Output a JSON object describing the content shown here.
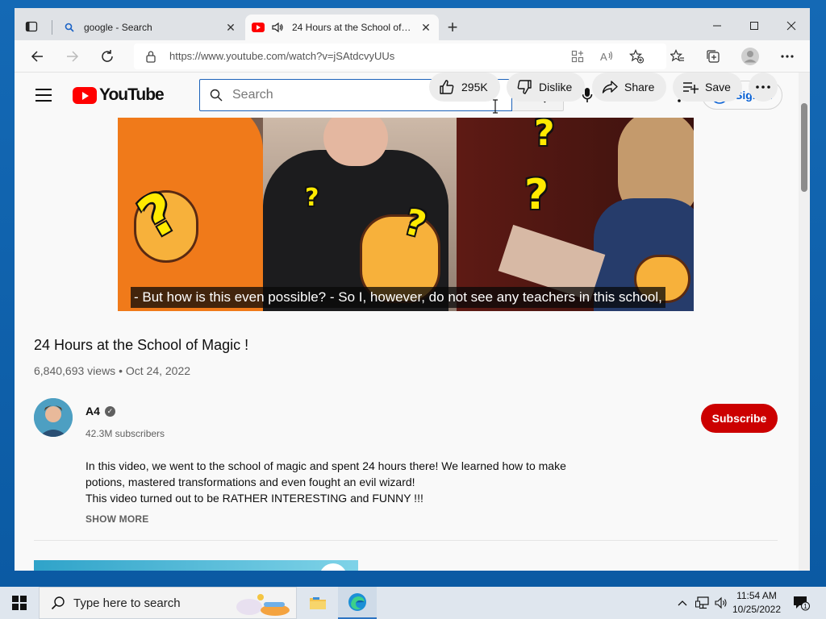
{
  "browser": {
    "tabs": [
      {
        "title": "google - Search",
        "active": false,
        "icon": "search-icon"
      },
      {
        "title": "24 Hours at the School of Magic",
        "active": true,
        "icon": "youtube-icon",
        "audio": true
      }
    ],
    "address_url": "https://www.youtube.com/watch?v=jSAtdcvyUUs"
  },
  "youtube": {
    "logo_text": "YouTube",
    "search_placeholder": "Search",
    "sign_in_label": "Sign in",
    "video": {
      "subtitle": "- But how is this even possible? - So I, however, do not see any teachers in this school,",
      "title": "24 Hours at the School of Magic !",
      "meta": "6,840,693 views • Oct 24, 2022"
    },
    "actions": {
      "like": "295K",
      "dislike": "Dislike",
      "share": "Share",
      "save": "Save"
    },
    "channel": {
      "name": "A4",
      "subscribers": "42.3M subscribers",
      "subscribe_label": "Subscribe"
    },
    "description": {
      "line1": "In this video, we went to the school of magic and spent 24 hours there! We learned how to make",
      "line2": "potions, mastered transformations and even fought an evil wizard!",
      "line3": "This video turned out to be RATHER INTERESTING and FUNNY !!!",
      "show_more": "SHOW MORE"
    }
  },
  "taskbar": {
    "search_placeholder": "Type here to search",
    "time": "11:54 AM",
    "date": "10/25/2022",
    "notification_count": "1"
  },
  "colors": {
    "youtube_red": "#ff0000",
    "subscribe_red": "#cc0000",
    "link_blue": "#065fd4",
    "search_focus_border": "#1c62b9"
  }
}
